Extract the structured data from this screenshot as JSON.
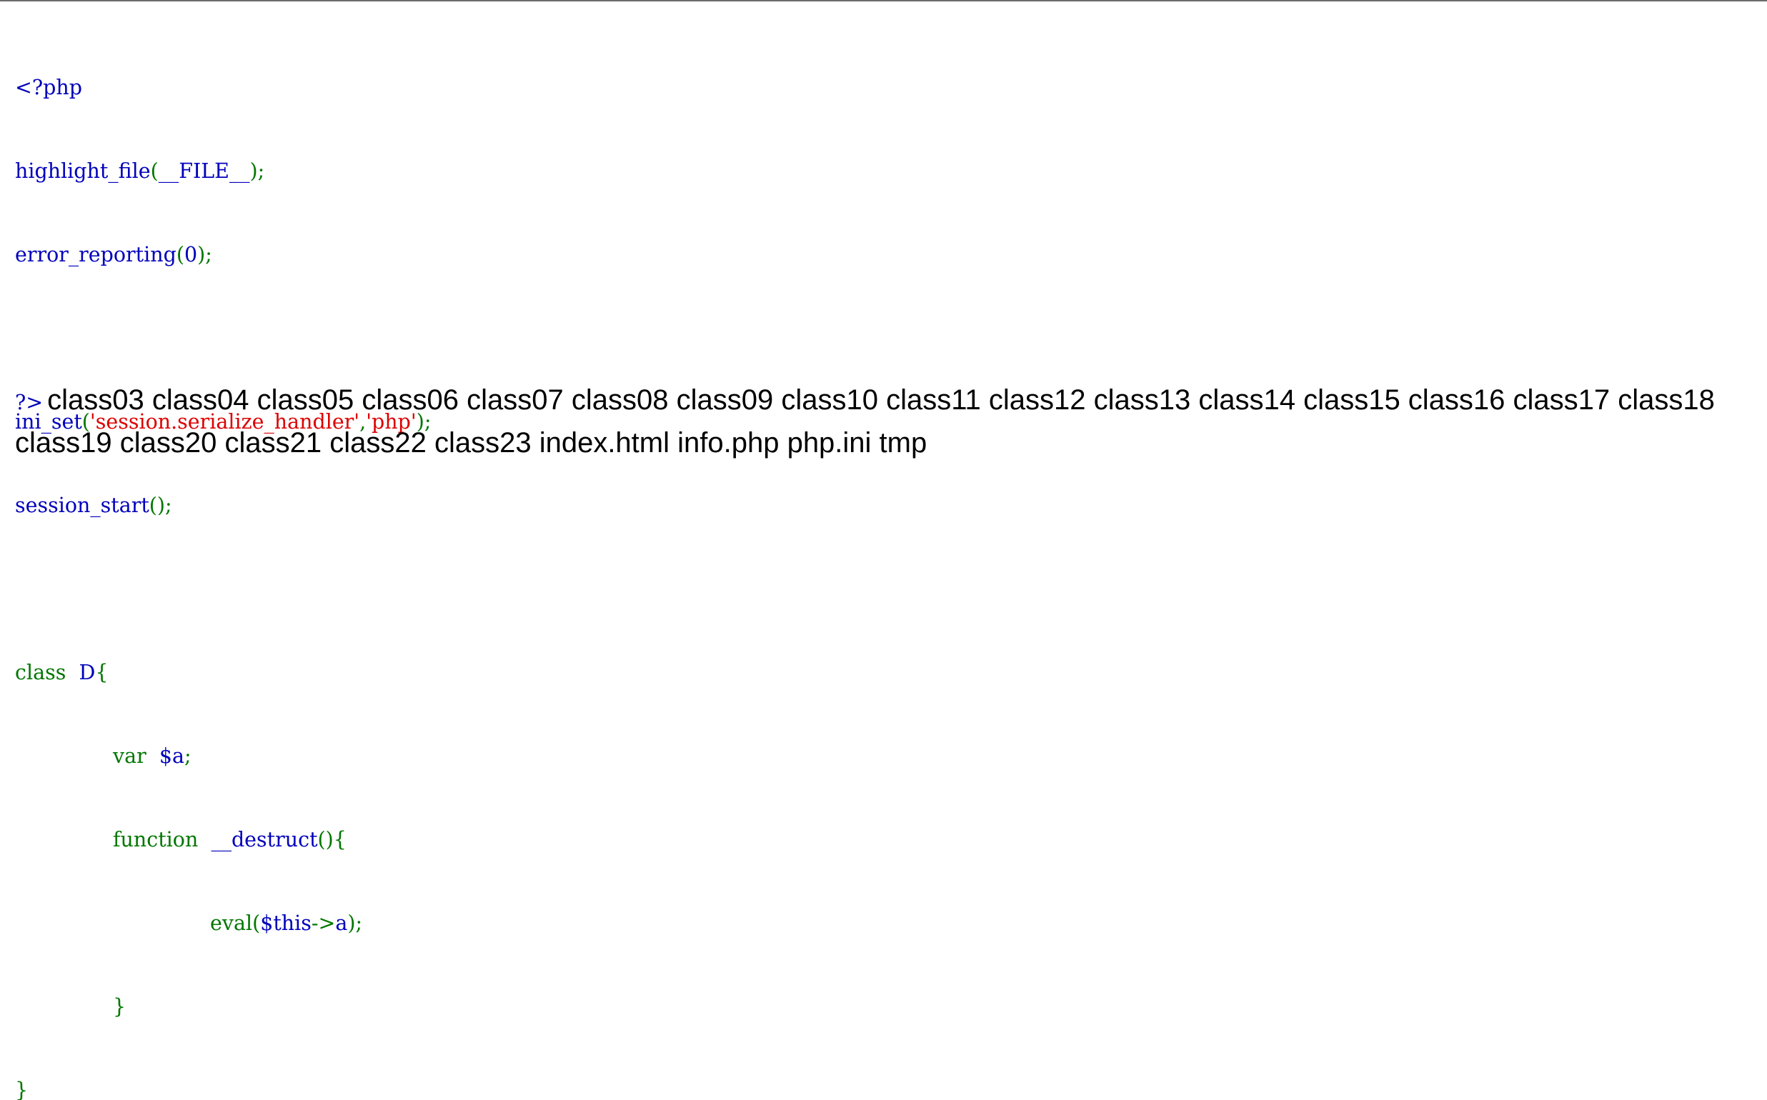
{
  "colors": {
    "keyword": "#007700",
    "identifier": "#0000bb",
    "string": "#dd0000",
    "text": "#000000"
  },
  "code": {
    "l1": "<?php",
    "l2_fn": "highlight_file",
    "l2_open": "(",
    "l2_arg": "__FILE__",
    "l2_close": ");",
    "l3_fn": "error_reporting",
    "l3_open": "(",
    "l3_arg": "0",
    "l3_close": ");",
    "l5_fn": "ini_set",
    "l5_open": "(",
    "l5_str1": "'session.serialize_handler'",
    "l5_comma": ",",
    "l5_str2": "'php'",
    "l5_close": ");",
    "l6_fn": "session_start",
    "l6_rest": "();",
    "l8_kw": "class ",
    "l8_name": "D",
    "l8_brace": "{",
    "l9_kw": "var ",
    "l9_var": "$a",
    "l9_semi": ";",
    "l10_kw": "function ",
    "l10_name": "__destruct",
    "l10_rest": "(){",
    "l11_fn": "eval",
    "l11_open": "(",
    "l11_var": "$this",
    "l11_arrow": "->",
    "l11_prop": "a",
    "l11_close": ");",
    "l12_brace": "}",
    "l13_brace": "}",
    "close_tag": "?>"
  },
  "output": {
    "listing": "class03 class04 class05 class06 class07 class08 class09 class10 class11 class12 class13 class14 class15 class16 class17 class18 class19 class20 class21 class22 class23 index.html info.php php.ini tmp"
  }
}
